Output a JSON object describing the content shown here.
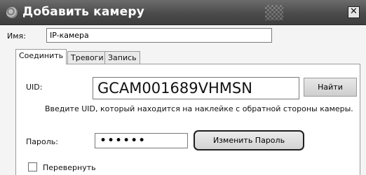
{
  "window": {
    "title": "Добавить камеру",
    "close_glyph": "✕",
    "icons": {
      "app": "camera-app-icon",
      "close": "close-icon"
    }
  },
  "form": {
    "name_label": "Имя:",
    "name_value": "IP-камера"
  },
  "tabs": [
    {
      "label": "Соединить",
      "active": true
    },
    {
      "label": "Тревоги",
      "active": false
    },
    {
      "label": "Запись",
      "active": false
    }
  ],
  "connect": {
    "uid_label": "UID:",
    "uid_value": "GCAM001689VHMSN",
    "find_label": "Найти",
    "hint": "Введите UID, который находится на наклейке с обратной стороны камеры.",
    "password_label": "Пароль:",
    "password_value": "••••••",
    "change_password_label": "Изменить Пароль",
    "flip_label": "Перевернуть",
    "flip_checked": false
  }
}
